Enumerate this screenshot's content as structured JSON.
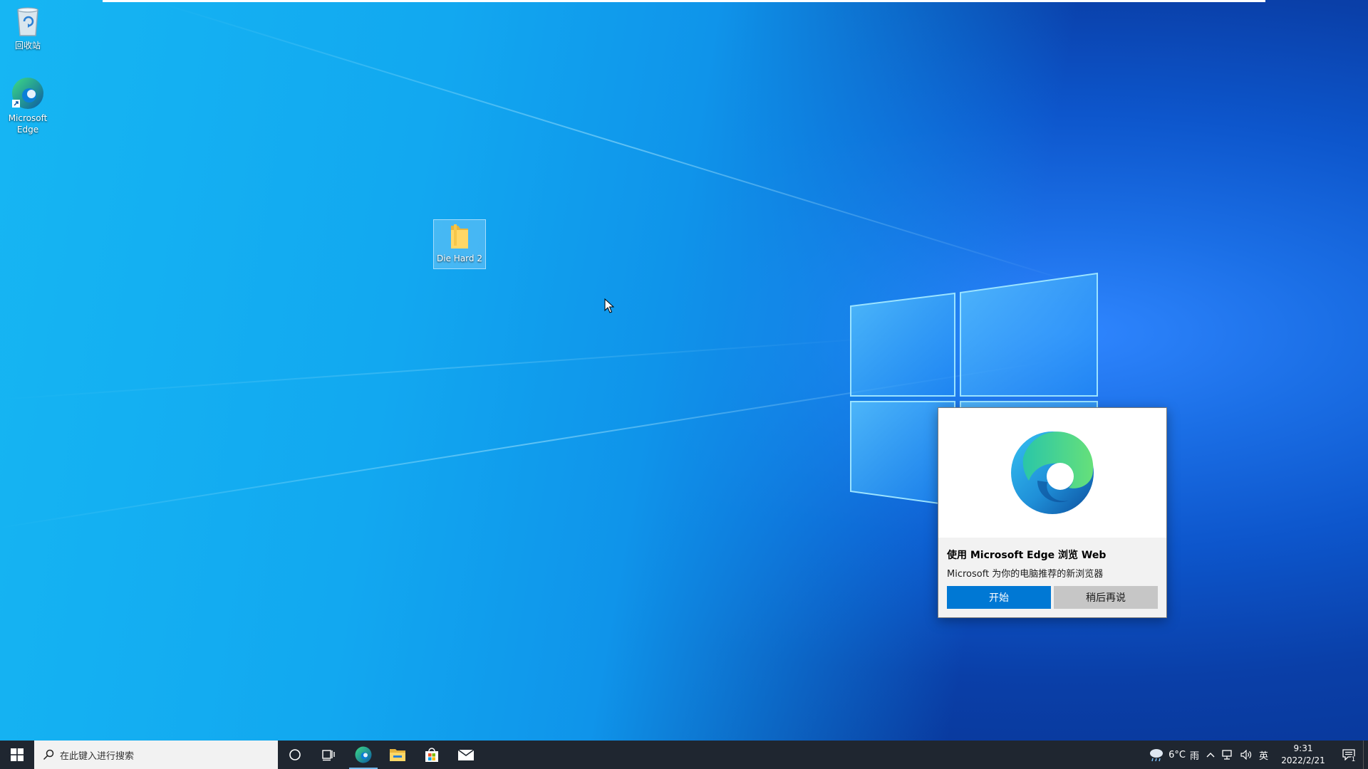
{
  "desktop": {
    "icons": [
      {
        "label": "回收站",
        "icon": "recycle-bin-icon"
      },
      {
        "label": "Microsoft Edge",
        "icon": "edge-icon"
      },
      {
        "label": "Die Hard 2",
        "icon": "folder-icon"
      }
    ]
  },
  "edge_prompt": {
    "title": "使用 Microsoft Edge 浏览 Web",
    "subtitle": "Microsoft 为你的电脑推荐的新浏览器",
    "start_label": "开始",
    "later_label": "稍后再说"
  },
  "taskbar": {
    "search_placeholder": "在此键入进行搜索",
    "pinned": [
      {
        "name": "cortana",
        "icon": "circle-icon"
      },
      {
        "name": "task-view",
        "icon": "task-view-icon"
      },
      {
        "name": "edge",
        "icon": "edge-icon",
        "active": true
      },
      {
        "name": "file-explorer",
        "icon": "folder-icon"
      },
      {
        "name": "store",
        "icon": "store-icon"
      },
      {
        "name": "mail",
        "icon": "mail-icon"
      }
    ],
    "tray": {
      "weather_temp": "6°C",
      "weather_desc": "雨",
      "ime": "英",
      "time": "9:31",
      "date": "2022/2/21",
      "notification_count": "1"
    }
  },
  "colors": {
    "accent": "#0078d4",
    "taskbar_bg": "#1f2630",
    "later_button": "#c6c6c6"
  }
}
